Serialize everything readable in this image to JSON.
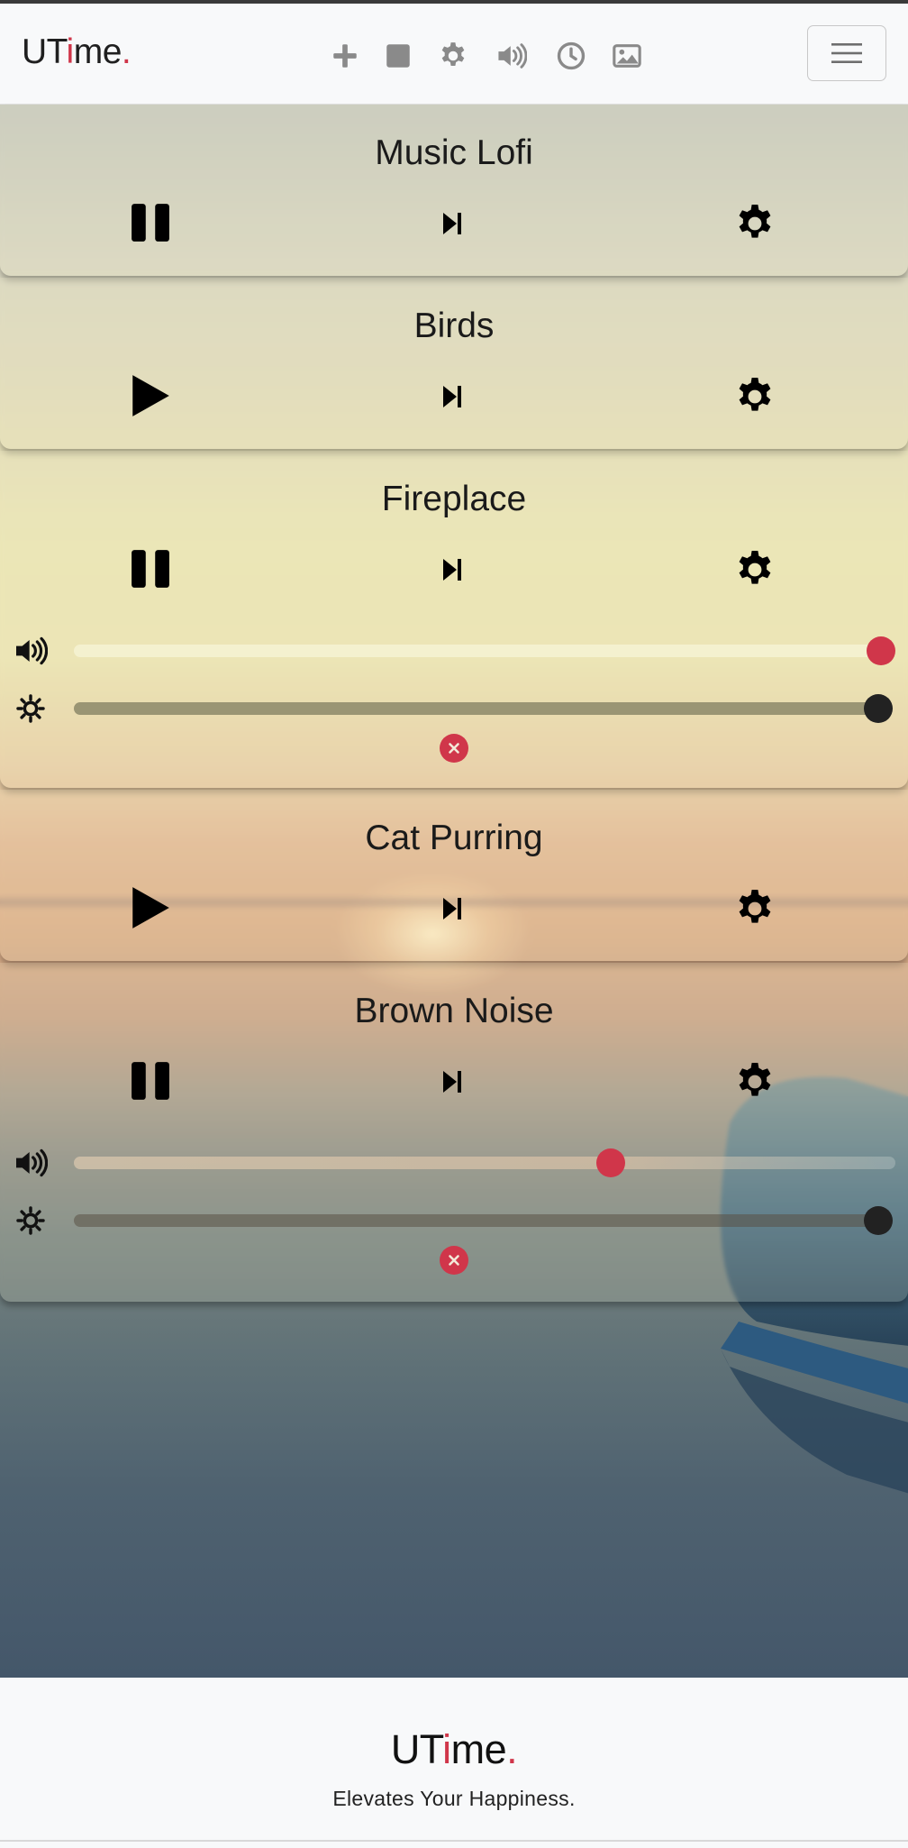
{
  "navbar": {
    "brand": {
      "prefix": "UT",
      "accent_letter": "i",
      "suffix": "me",
      "dot": "."
    },
    "icons": [
      "plus-icon",
      "stop-icon",
      "gear-icon",
      "volume-icon",
      "clock-icon",
      "image-icon"
    ],
    "menu_icon": "hamburger-icon"
  },
  "colors": {
    "accent": "#d0364a",
    "navbar_bg": "#f8f9fa",
    "icon_gray": "#8a8a8a",
    "thumb_dark": "#222222"
  },
  "sounds": [
    {
      "title": "Music Lofi",
      "state": "playing",
      "expanded": false
    },
    {
      "title": "Birds",
      "state": "paused",
      "expanded": false
    },
    {
      "title": "Fireplace",
      "state": "playing",
      "expanded": true,
      "volume": 1.0,
      "brightness": 1.0
    },
    {
      "title": "Cat Purring",
      "state": "paused",
      "expanded": false
    },
    {
      "title": "Brown Noise",
      "state": "playing",
      "expanded": true,
      "volume": 0.65,
      "brightness": 1.0
    }
  ],
  "footer": {
    "brand": {
      "prefix": "UT",
      "accent_letter": "i",
      "suffix": "me",
      "dot": "."
    },
    "tagline": "Elevates Your Happiness."
  }
}
